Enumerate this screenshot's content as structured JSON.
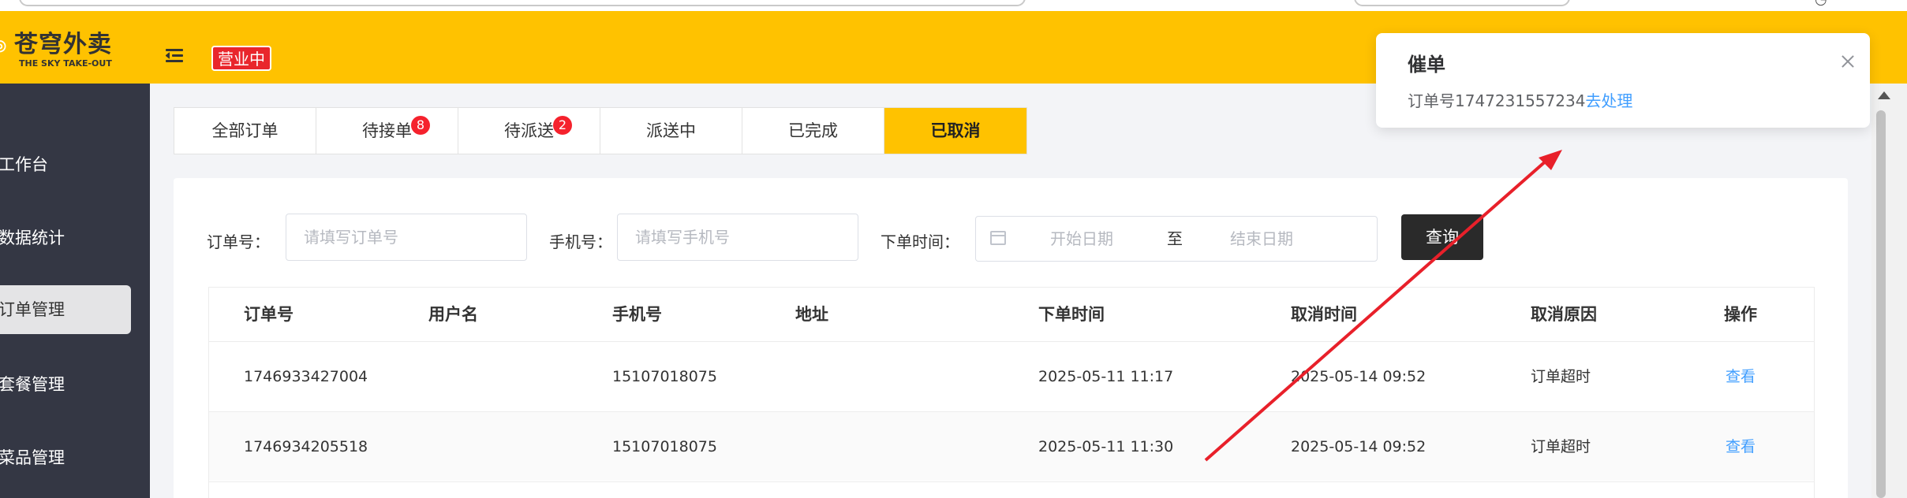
{
  "brand": {
    "name_cn": "苍穹外卖",
    "name_en": "THE SKY TAKE-OUT",
    "logo_icon": "logo-icon"
  },
  "header": {
    "menu_icon": "menu-fold-icon",
    "status": "营业中"
  },
  "sidebar": {
    "items": [
      {
        "label": "工作台"
      },
      {
        "label": "数据统计"
      },
      {
        "label": "订单管理",
        "active": true
      },
      {
        "label": "套餐管理"
      },
      {
        "label": "菜品管理"
      }
    ]
  },
  "tabs": [
    {
      "label": "全部订单"
    },
    {
      "label": "待接单",
      "count": "8"
    },
    {
      "label": "待派送",
      "count": "2"
    },
    {
      "label": "派送中"
    },
    {
      "label": "已完成"
    },
    {
      "label": "已取消",
      "active": true
    }
  ],
  "filters": {
    "order_no_label": "订单号：",
    "order_no_placeholder": "请填写订单号",
    "phone_label": "手机号：",
    "phone_placeholder": "请填写手机号",
    "time_label": "下单时间：",
    "start_placeholder": "开始日期",
    "range_sep": "至",
    "end_placeholder": "结束日期",
    "query_button": "查询"
  },
  "table": {
    "headers": [
      "订单号",
      "用户名",
      "手机号",
      "地址",
      "下单时间",
      "取消时间",
      "取消原因",
      "操作"
    ],
    "rows": [
      {
        "order_no": "1746933427004",
        "user": "",
        "phone": "15107018075",
        "address": "",
        "order_time": "2025-05-11 11:17",
        "cancel_time": "2025-05-14 09:52",
        "reason": "订单超时",
        "action": "查看"
      },
      {
        "order_no": "1746934205518",
        "user": "",
        "phone": "15107018075",
        "address": "",
        "order_time": "2025-05-11 11:30",
        "cancel_time": "2025-05-14 09:52",
        "reason": "订单超时",
        "action": "查看"
      }
    ]
  },
  "notification": {
    "title": "催单",
    "message_prefix": "订单号1747231557234",
    "link_text": "去处理"
  },
  "colors": {
    "accent": "#ffc200",
    "sidebar": "#343744",
    "badge": "#e9262c",
    "link": "#409eff",
    "arrow": "#e8202a"
  }
}
